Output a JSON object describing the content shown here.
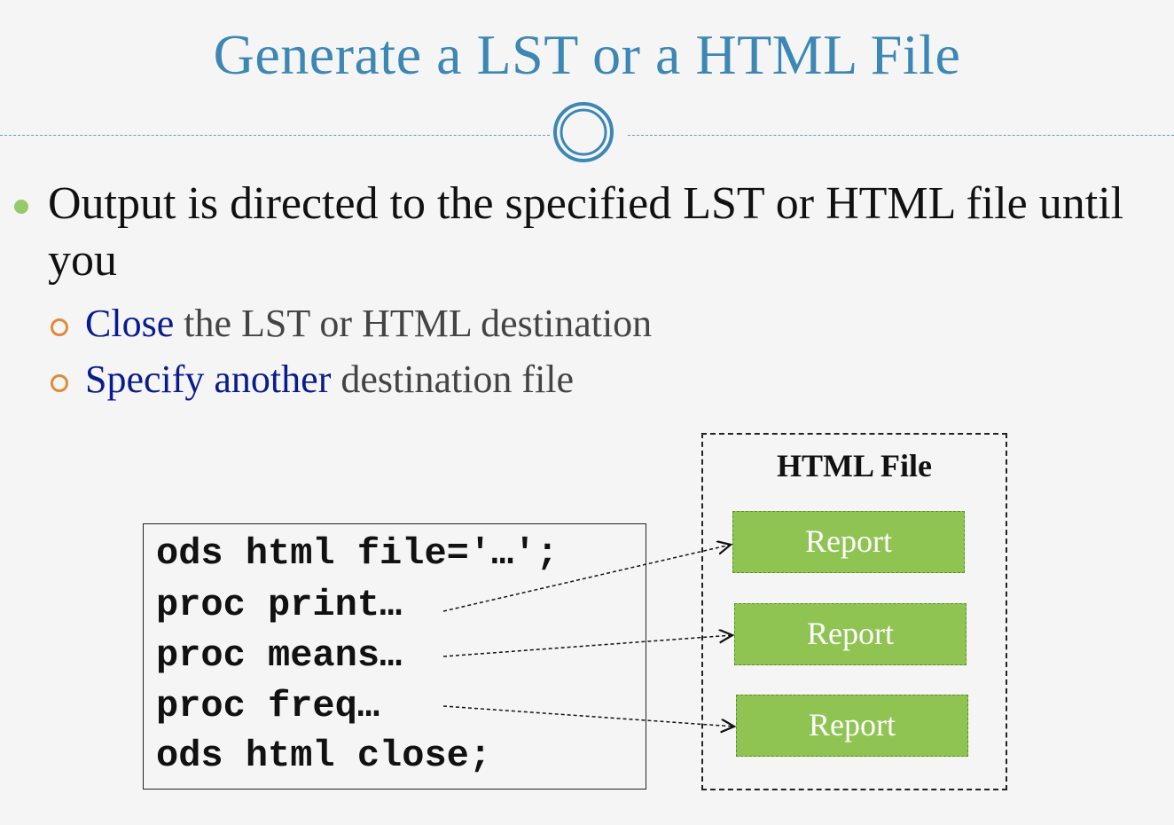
{
  "slide": {
    "title": "Generate a LST or a HTML File",
    "bullet": {
      "text": "Output is directed to the specified LST or HTML file until you"
    },
    "sub_bullets": [
      {
        "highlight": "Close",
        "rest": " the LST or HTML destination"
      },
      {
        "highlight": "Specify another",
        "rest": " destination file"
      }
    ]
  },
  "code_lines": [
    "ods html file='…';",
    "proc print…",
    "proc means…",
    "proc freq…",
    "ods html close;"
  ],
  "html_file": {
    "title": "HTML File",
    "reports": [
      "Report",
      "Report",
      "Report"
    ]
  },
  "colors": {
    "title": "#3d87b5",
    "highlight": "#0a1c8c",
    "report_fill": "#8fc453",
    "bullet_dot": "#96c96a",
    "sub_bullet_ring": "#e08a3c"
  }
}
